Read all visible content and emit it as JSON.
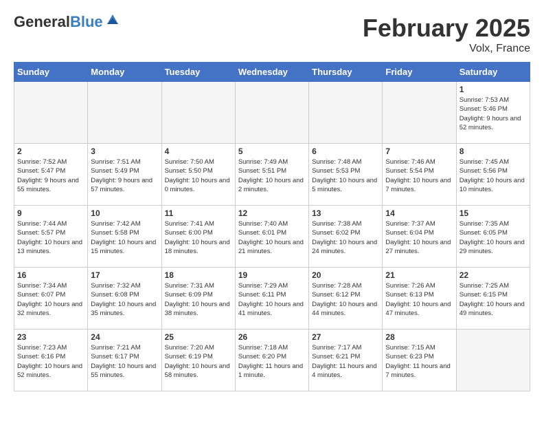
{
  "header": {
    "logo_general": "General",
    "logo_blue": "Blue",
    "title": "February 2025",
    "subtitle": "Volx, France"
  },
  "days_of_week": [
    "Sunday",
    "Monday",
    "Tuesday",
    "Wednesday",
    "Thursday",
    "Friday",
    "Saturday"
  ],
  "weeks": [
    [
      {
        "day": "",
        "info": ""
      },
      {
        "day": "",
        "info": ""
      },
      {
        "day": "",
        "info": ""
      },
      {
        "day": "",
        "info": ""
      },
      {
        "day": "",
        "info": ""
      },
      {
        "day": "",
        "info": ""
      },
      {
        "day": "1",
        "info": "Sunrise: 7:53 AM\nSunset: 5:46 PM\nDaylight: 9 hours and 52 minutes."
      }
    ],
    [
      {
        "day": "2",
        "info": "Sunrise: 7:52 AM\nSunset: 5:47 PM\nDaylight: 9 hours and 55 minutes."
      },
      {
        "day": "3",
        "info": "Sunrise: 7:51 AM\nSunset: 5:49 PM\nDaylight: 9 hours and 57 minutes."
      },
      {
        "day": "4",
        "info": "Sunrise: 7:50 AM\nSunset: 5:50 PM\nDaylight: 10 hours and 0 minutes."
      },
      {
        "day": "5",
        "info": "Sunrise: 7:49 AM\nSunset: 5:51 PM\nDaylight: 10 hours and 2 minutes."
      },
      {
        "day": "6",
        "info": "Sunrise: 7:48 AM\nSunset: 5:53 PM\nDaylight: 10 hours and 5 minutes."
      },
      {
        "day": "7",
        "info": "Sunrise: 7:46 AM\nSunset: 5:54 PM\nDaylight: 10 hours and 7 minutes."
      },
      {
        "day": "8",
        "info": "Sunrise: 7:45 AM\nSunset: 5:56 PM\nDaylight: 10 hours and 10 minutes."
      }
    ],
    [
      {
        "day": "9",
        "info": "Sunrise: 7:44 AM\nSunset: 5:57 PM\nDaylight: 10 hours and 13 minutes."
      },
      {
        "day": "10",
        "info": "Sunrise: 7:42 AM\nSunset: 5:58 PM\nDaylight: 10 hours and 15 minutes."
      },
      {
        "day": "11",
        "info": "Sunrise: 7:41 AM\nSunset: 6:00 PM\nDaylight: 10 hours and 18 minutes."
      },
      {
        "day": "12",
        "info": "Sunrise: 7:40 AM\nSunset: 6:01 PM\nDaylight: 10 hours and 21 minutes."
      },
      {
        "day": "13",
        "info": "Sunrise: 7:38 AM\nSunset: 6:02 PM\nDaylight: 10 hours and 24 minutes."
      },
      {
        "day": "14",
        "info": "Sunrise: 7:37 AM\nSunset: 6:04 PM\nDaylight: 10 hours and 27 minutes."
      },
      {
        "day": "15",
        "info": "Sunrise: 7:35 AM\nSunset: 6:05 PM\nDaylight: 10 hours and 29 minutes."
      }
    ],
    [
      {
        "day": "16",
        "info": "Sunrise: 7:34 AM\nSunset: 6:07 PM\nDaylight: 10 hours and 32 minutes."
      },
      {
        "day": "17",
        "info": "Sunrise: 7:32 AM\nSunset: 6:08 PM\nDaylight: 10 hours and 35 minutes."
      },
      {
        "day": "18",
        "info": "Sunrise: 7:31 AM\nSunset: 6:09 PM\nDaylight: 10 hours and 38 minutes."
      },
      {
        "day": "19",
        "info": "Sunrise: 7:29 AM\nSunset: 6:11 PM\nDaylight: 10 hours and 41 minutes."
      },
      {
        "day": "20",
        "info": "Sunrise: 7:28 AM\nSunset: 6:12 PM\nDaylight: 10 hours and 44 minutes."
      },
      {
        "day": "21",
        "info": "Sunrise: 7:26 AM\nSunset: 6:13 PM\nDaylight: 10 hours and 47 minutes."
      },
      {
        "day": "22",
        "info": "Sunrise: 7:25 AM\nSunset: 6:15 PM\nDaylight: 10 hours and 49 minutes."
      }
    ],
    [
      {
        "day": "23",
        "info": "Sunrise: 7:23 AM\nSunset: 6:16 PM\nDaylight: 10 hours and 52 minutes."
      },
      {
        "day": "24",
        "info": "Sunrise: 7:21 AM\nSunset: 6:17 PM\nDaylight: 10 hours and 55 minutes."
      },
      {
        "day": "25",
        "info": "Sunrise: 7:20 AM\nSunset: 6:19 PM\nDaylight: 10 hours and 58 minutes."
      },
      {
        "day": "26",
        "info": "Sunrise: 7:18 AM\nSunset: 6:20 PM\nDaylight: 11 hours and 1 minute."
      },
      {
        "day": "27",
        "info": "Sunrise: 7:17 AM\nSunset: 6:21 PM\nDaylight: 11 hours and 4 minutes."
      },
      {
        "day": "28",
        "info": "Sunrise: 7:15 AM\nSunset: 6:23 PM\nDaylight: 11 hours and 7 minutes."
      },
      {
        "day": "",
        "info": ""
      }
    ]
  ]
}
